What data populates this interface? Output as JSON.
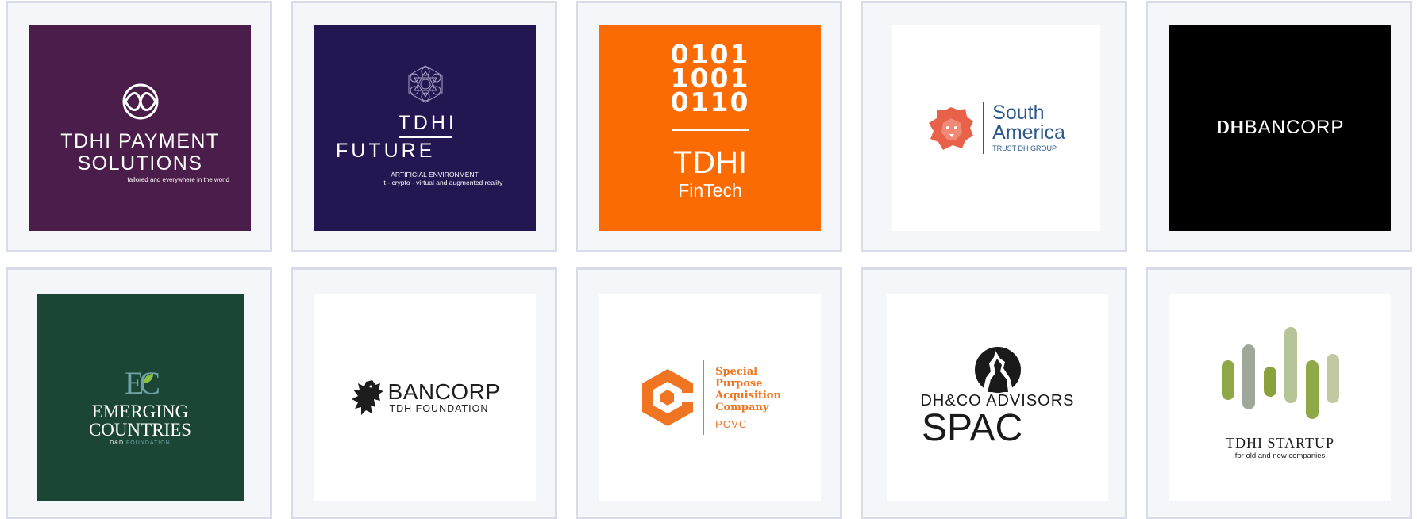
{
  "logos": {
    "payment": {
      "name_line1": "TDHI PAYMENT",
      "name_line2": "SOLUTIONS",
      "tagline": "tailored and everywhere in the world",
      "bg": "#4b1d4a",
      "icon": "infinity-ribbon-icon"
    },
    "future": {
      "name_line1": "TDHI",
      "name_line2": "FUTURE",
      "tagline_line1": "ARTIFICIAL ENVIRONMENT",
      "tagline_line2": "it - crypto - virtual and augmented reality",
      "bg": "#241651",
      "icon": "metatron-cube-icon"
    },
    "fintech": {
      "binary_line1": "0101",
      "binary_line2": "1001",
      "binary_line3": "0110",
      "name": "TDHI",
      "subname": "FinTech",
      "bg": "#fa6b04"
    },
    "south_america": {
      "name_line1": "South",
      "name_line2": "America",
      "tagline": "TRUST DH GROUP",
      "accent": "#e8624a",
      "text_color": "#2c5a8a",
      "icon": "lion-head-icon"
    },
    "dhbancorp": {
      "prefix": "DH",
      "suffix": "BANCORP",
      "bg": "#000000"
    },
    "emerging": {
      "mark": "EC",
      "name_line1": "EMERGING",
      "name_line2": "COUNTRIES",
      "tagline_a": "D&D",
      "tagline_b": "FOUNDATION",
      "bg": "#1b4635",
      "icon": "leaf-icon"
    },
    "bancorp_tdh": {
      "name": "BANCORP",
      "tagline": "TDH FOUNDATION",
      "icon": "heraldic-lion-icon"
    },
    "pcvc": {
      "line1": "Special",
      "line2": "Purpose",
      "line3": "Acquisition",
      "line4": "Company",
      "abbr": "PCVC",
      "accent": "#f07522",
      "icon": "hexagon-c-icon"
    },
    "dhco_spac": {
      "name": "DH&CO ADVISORS",
      "subname": "SPAC",
      "icon": "howling-wolf-icon"
    },
    "startup": {
      "name": "TDHI STARTUP",
      "tagline": "for old and new companies",
      "bar_colors": [
        "#8fa848",
        "#9fa898",
        "#8aa23c",
        "#b7c498",
        "#8fa848",
        "#c2c8a2"
      ],
      "icon": "equalizer-bars-icon"
    }
  }
}
